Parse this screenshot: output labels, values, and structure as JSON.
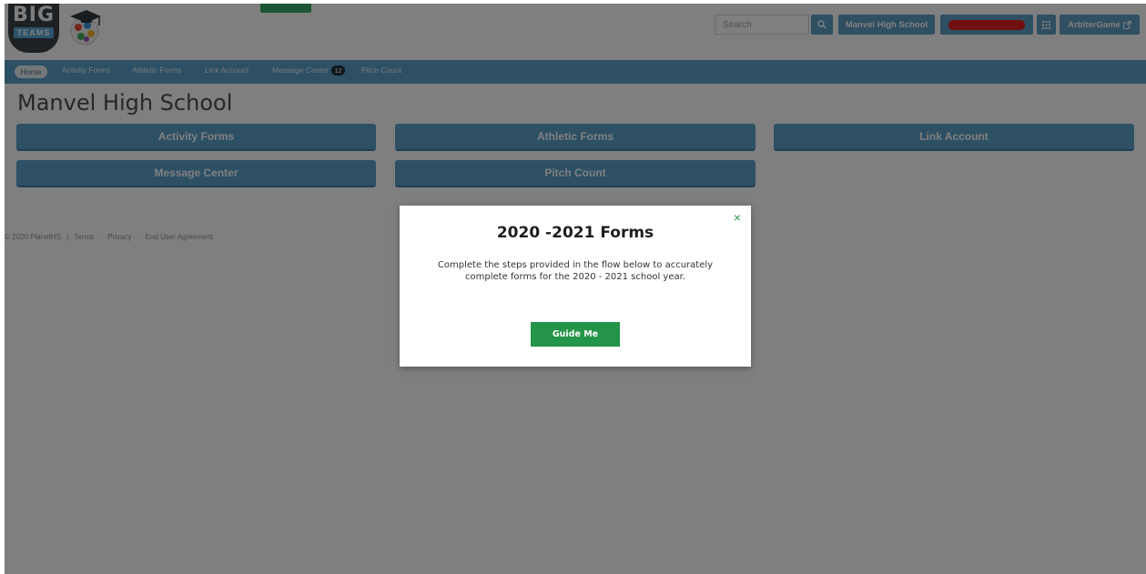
{
  "header": {
    "logo_big": "BIG",
    "logo_teams": "TEAMS",
    "search_placeholder": "Search",
    "school_button": "Manvel High School",
    "arbiter_button": "ArbiterGame"
  },
  "nav": {
    "home": "Home",
    "activity_forms": "Activity Forms",
    "athletic_forms": "Athletic Forms",
    "link_account": "Link Account",
    "message_center": "Message Center",
    "message_count": "12",
    "pitch_count": "Pitch Count"
  },
  "main": {
    "title": "Manvel High School",
    "tiles": {
      "activity_forms": "Activity Forms",
      "athletic_forms": "Athletic Forms",
      "link_account": "Link Account",
      "message_center": "Message Center",
      "pitch_count": "Pitch Count"
    }
  },
  "footer": {
    "copyright": "© 2020 PlanetHS",
    "sep": "|",
    "terms": "Terms",
    "dot": "·",
    "privacy": "Privacy",
    "eula": "End User Agreement"
  },
  "modal": {
    "title": "2020 -2021 Forms",
    "body": "Complete the steps provided in the flow below to accurately complete forms for the 2020 - 2021 school year.",
    "button": "Guide Me",
    "close": "×"
  },
  "colors": {
    "accent_blue": "#5aa1cb",
    "green": "#239448",
    "redaction": "#e0201e"
  }
}
